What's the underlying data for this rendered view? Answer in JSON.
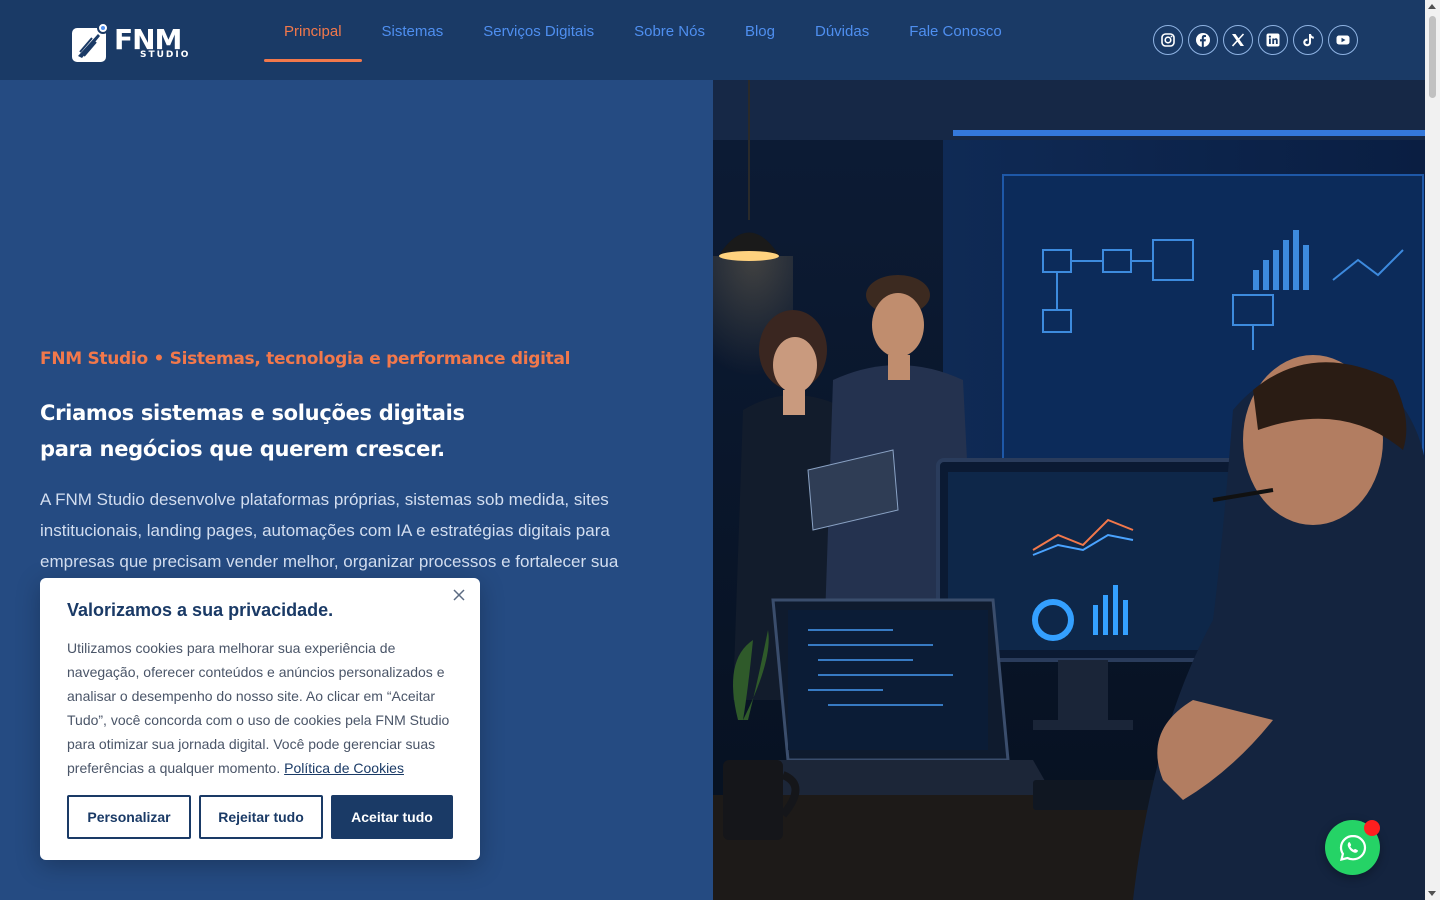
{
  "brand": {
    "name": "FNM",
    "sub": "STUDIO",
    "accent": "#f2784b",
    "primary": "#1a3a66"
  },
  "nav": {
    "items": [
      {
        "label": "Principal",
        "active": true
      },
      {
        "label": "Sistemas"
      },
      {
        "label": "Serviços Digitais"
      },
      {
        "label": "Sobre Nós"
      },
      {
        "label": "Blog"
      },
      {
        "label": "Dúvidas"
      },
      {
        "label": "Fale Conosco"
      }
    ]
  },
  "social": [
    "instagram-icon",
    "facebook-icon",
    "x-icon",
    "linkedin-icon",
    "tiktok-icon",
    "youtube-icon"
  ],
  "hero": {
    "eyebrow": "FNM Studio • Sistemas, tecnologia e performance digital",
    "headline_1": "Criamos sistemas e soluções digitais",
    "headline_2": "para negócios que querem crescer.",
    "lead": "A FNM Studio desenvolve plataformas próprias, sistemas sob medida, sites institucionais, landing pages, automações com IA e estratégias digitais para empresas que precisam vender melhor, organizar processos e fortalecer sua"
  },
  "cookie": {
    "title": "Valorizamos a sua privacidade.",
    "body": "Utilizamos cookies para melhorar sua experiência de navegação, oferecer conteúdos e anúncios personalizados e analisar o desempenho do nosso site. Ao clicar em “Aceitar Tudo”, você concorda com o uso de cookies pela FNM Studio para otimizar sua jornada digital. Você pode gerenciar suas preferências a qualquer momento.",
    "link": "Política de Cookies",
    "customize": "Personalizar",
    "reject": "Rejeitar tudo",
    "accept": "Aceitar tudo"
  }
}
